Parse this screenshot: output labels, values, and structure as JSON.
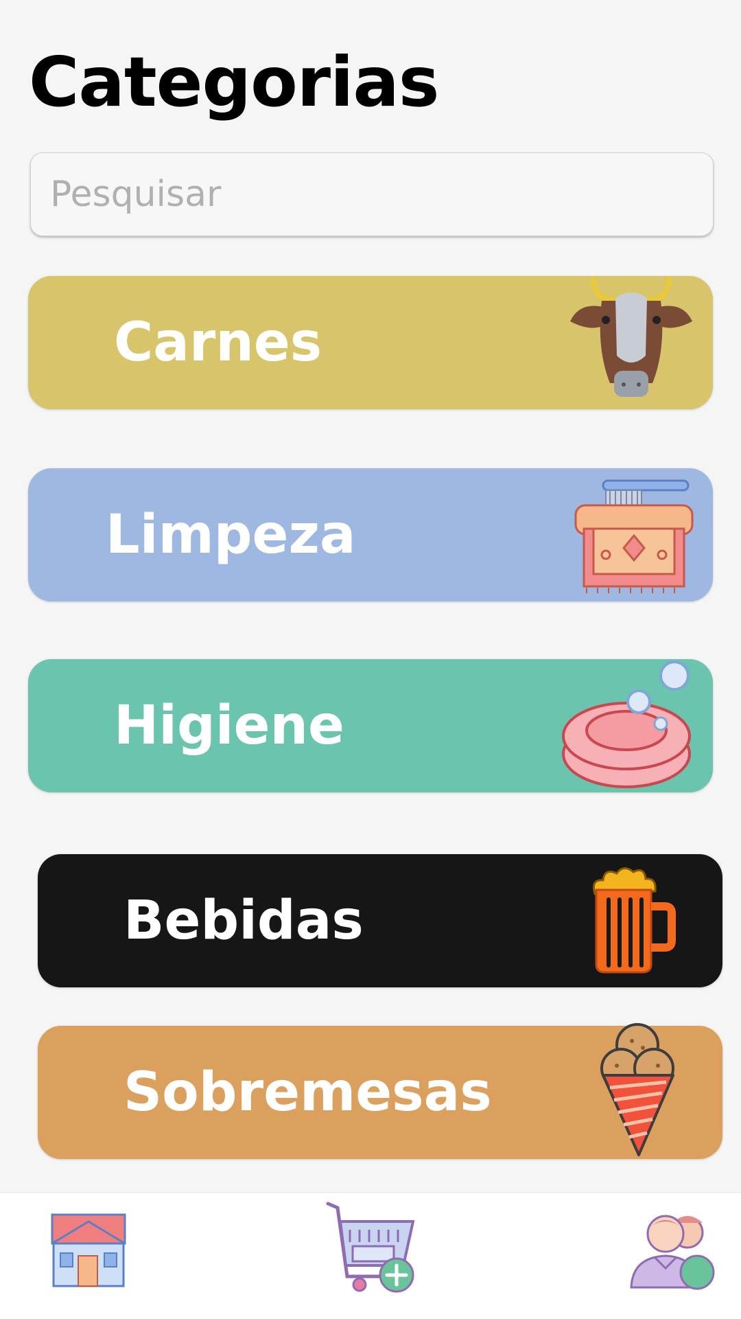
{
  "header": {
    "title": "Categorias"
  },
  "search": {
    "placeholder": "Pesquisar",
    "value": ""
  },
  "categories": [
    {
      "label": "Carnes",
      "color": "#d7c46b",
      "icon": "cow-icon"
    },
    {
      "label": "Limpeza",
      "color": "#9eb8e2",
      "icon": "cleaning-brush-icon"
    },
    {
      "label": "Higiene",
      "color": "#6ac4ae",
      "icon": "soap-icon"
    },
    {
      "label": "Bebidas",
      "color": "#161616",
      "icon": "beer-mug-icon"
    },
    {
      "label": "Sobremesas",
      "color": "#dca05e",
      "icon": "ice-cream-cone-icon"
    }
  ],
  "bottom_nav": {
    "items": [
      {
        "icon": "home-icon"
      },
      {
        "icon": "add-to-cart-icon"
      },
      {
        "icon": "add-user-icon"
      }
    ]
  }
}
